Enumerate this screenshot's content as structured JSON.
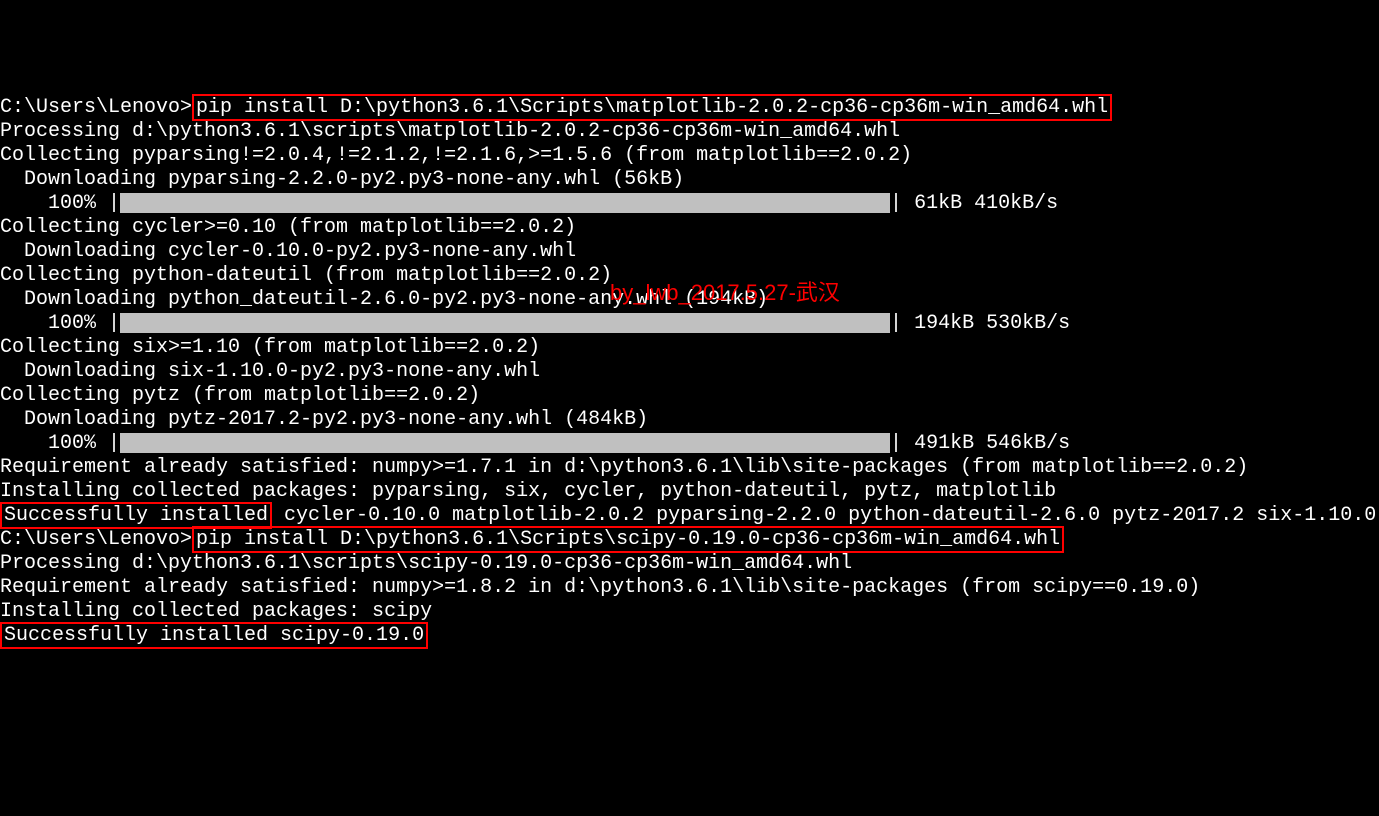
{
  "terminal": {
    "prompt": "C:\\Users\\Lenovo>",
    "cmd1": "pip install D:\\python3.6.1\\Scripts\\matplotlib-2.0.2-cp36-cp36m-win_amd64.whl",
    "line1": "Processing d:\\python3.6.1\\scripts\\matplotlib-2.0.2-cp36-cp36m-win_amd64.whl",
    "line2": "Collecting pyparsing!=2.0.4,!=2.1.2,!=2.1.6,>=1.5.6 (from matplotlib==2.0.2)",
    "line3": "  Downloading pyparsing-2.2.0-py2.py3-none-any.whl (56kB)",
    "progress1_pct": "    100% ",
    "progress1_sep": "|",
    "progress1_info": " 61kB 410kB/s",
    "line5": "Collecting cycler>=0.10 (from matplotlib==2.0.2)",
    "line6": "  Downloading cycler-0.10.0-py2.py3-none-any.whl",
    "line7": "Collecting python-dateutil (from matplotlib==2.0.2)",
    "line8": "  Downloading python_dateutil-2.6.0-py2.py3-none-any.whl (194kB)",
    "progress2_pct": "    100% ",
    "progress2_sep": "|",
    "progress2_info": " 194kB 530kB/s",
    "line10": "Collecting six>=1.10 (from matplotlib==2.0.2)",
    "line11": "  Downloading six-1.10.0-py2.py3-none-any.whl",
    "line12": "Collecting pytz (from matplotlib==2.0.2)",
    "line13": "  Downloading pytz-2017.2-py2.py3-none-any.whl (484kB)",
    "progress3_pct": "    100% ",
    "progress3_sep": "|",
    "progress3_info": " 491kB 546kB/s",
    "line15": "Requirement already satisfied: numpy>=1.7.1 in d:\\python3.6.1\\lib\\site-packages (from matplotlib==2.0.2)",
    "line16": "Installing collected packages: pyparsing, six, cycler, python-dateutil, pytz, matplotlib",
    "success1_box": "Successfully installed",
    "success1_rest": " cycler-0.10.0 matplotlib-2.0.2 pyparsing-2.2.0 python-dateutil-2.6.0 pytz-2017.2 six-1.10.0",
    "blank": "",
    "cmd2": "pip install D:\\python3.6.1\\Scripts\\scipy-0.19.0-cp36-cp36m-win_amd64.whl",
    "line18": "Processing d:\\python3.6.1\\scripts\\scipy-0.19.0-cp36-cp36m-win_amd64.whl",
    "line19": "Requirement already satisfied: numpy>=1.8.2 in d:\\python3.6.1\\lib\\site-packages (from scipy==0.19.0)",
    "line20": "Installing collected packages: scipy",
    "success2_box": "Successfully installed scipy-0.19.0"
  },
  "watermark": "by_lwb_2017.5.27-武汉"
}
